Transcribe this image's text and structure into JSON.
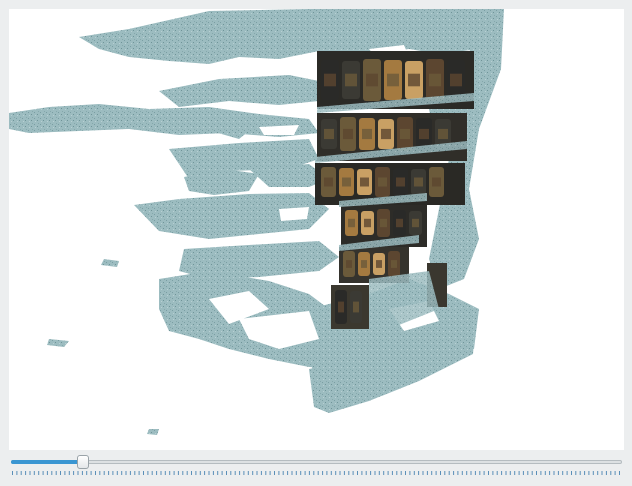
{
  "viewer": {
    "scene": "3d-point-cloud",
    "point_color": "#9cbcc0",
    "point_dark": "#7a9ea3",
    "texture_colors": [
      "#2a2a28",
      "#3b3a34",
      "#6b5a3a",
      "#a47a40",
      "#c9a064",
      "#5c4630"
    ]
  },
  "slider": {
    "value": 0.11,
    "fill_color": "#3a96d2",
    "tick_color": "#5a8fb8",
    "tick_count": 140
  }
}
